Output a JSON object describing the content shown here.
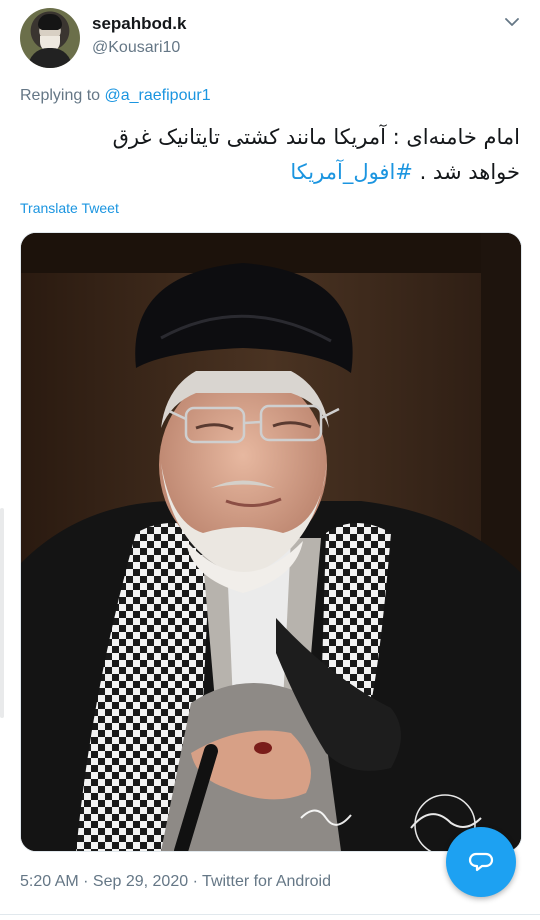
{
  "tweet": {
    "display_name": "sepahbod.k",
    "handle": "@Kousari10",
    "replying_prefix": "Replying to",
    "replying_to": "@a_raefipour1",
    "text_line1": "امام خامنه‌ای : آمریکا مانند کشتی تایتانیک غرق",
    "text_line2_plain": "خواهد شد . ",
    "text_hashtag": "#افول_آمریکا",
    "translate_label": "Translate Tweet",
    "meta": "5:20 AM · Sep 29, 2020 · Twitter for Android"
  },
  "icons": {
    "menu": "chevron-down-icon",
    "compose": "reply-bubble-icon"
  },
  "colors": {
    "link": "#1b95e0",
    "fab": "#1da1f2",
    "secondary_text": "#657786"
  }
}
